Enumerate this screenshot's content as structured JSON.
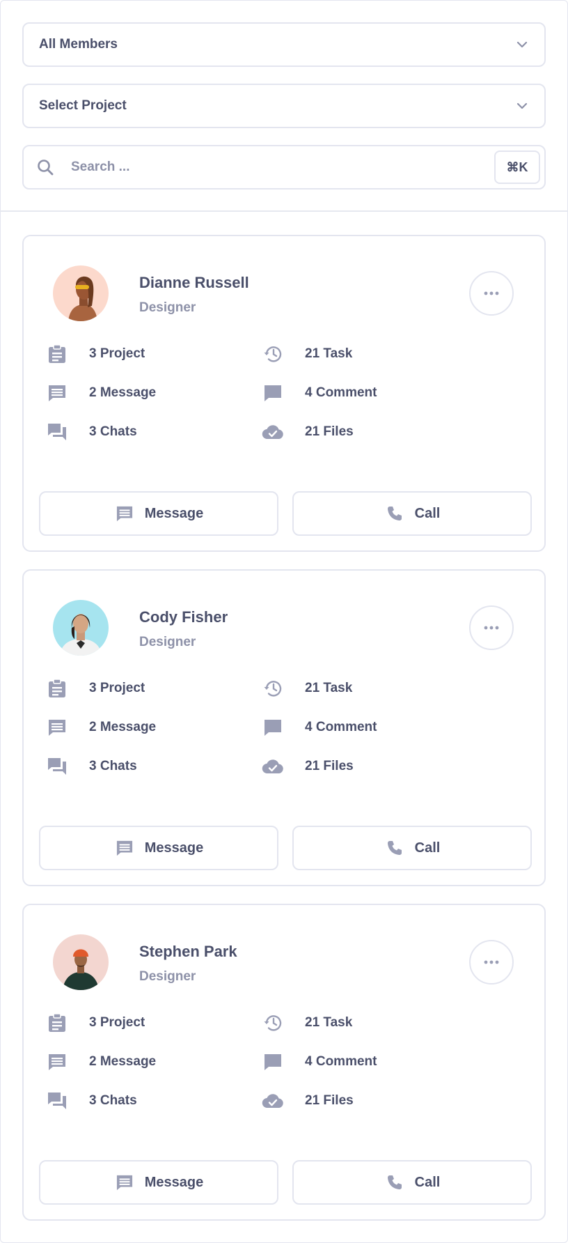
{
  "filters": {
    "members_select": {
      "value": "All Members"
    },
    "project_select": {
      "value": "Select Project"
    },
    "search": {
      "placeholder": "Search ...",
      "shortcut": "⌘K"
    }
  },
  "colors": {
    "border": "#e3e5ef",
    "text": "#4a4f6a",
    "muted": "#8d91a8",
    "icon": "#9a9eb5"
  },
  "members": [
    {
      "name": "Dianne Russell",
      "role": "Designer",
      "avatar_bg": "#fcd9cc",
      "stats": {
        "projects": "3 Project",
        "tasks": "21 Task",
        "messages": "2 Message",
        "comments": "4 Comment",
        "chats": "3 Chats",
        "files": "21 Files"
      },
      "actions": {
        "message": "Message",
        "call": "Call"
      }
    },
    {
      "name": "Cody Fisher",
      "role": "Designer",
      "avatar_bg": "#a6e4ef",
      "stats": {
        "projects": "3 Project",
        "tasks": "21 Task",
        "messages": "2 Message",
        "comments": "4 Comment",
        "chats": "3 Chats",
        "files": "21 Files"
      },
      "actions": {
        "message": "Message",
        "call": "Call"
      }
    },
    {
      "name": "Stephen Park",
      "role": "Designer",
      "avatar_bg": "#f3d6d0",
      "stats": {
        "projects": "3 Project",
        "tasks": "21 Task",
        "messages": "2 Message",
        "comments": "4 Comment",
        "chats": "3 Chats",
        "files": "21 Files"
      },
      "actions": {
        "message": "Message",
        "call": "Call"
      }
    }
  ]
}
